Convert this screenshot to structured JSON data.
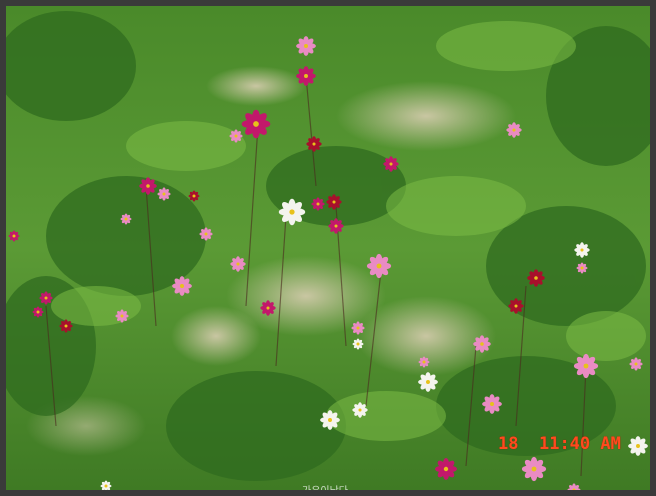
{
  "photo": {
    "subject": "cosmos-flowers-in-field",
    "timestamp_day": "18",
    "timestamp_time": "11:40 AM",
    "watermark": "가우이낭다",
    "colors": {
      "grass_dark": "#2f6b1f",
      "grass_light": "#6fae3c",
      "soil": "#c9c2a0",
      "flower_magenta": "#c2186b",
      "flower_pink": "#e98bc3",
      "flower_white": "#f4f4ee",
      "flower_crimson": "#a8102c",
      "timestamp": "#ff4a1e"
    }
  }
}
